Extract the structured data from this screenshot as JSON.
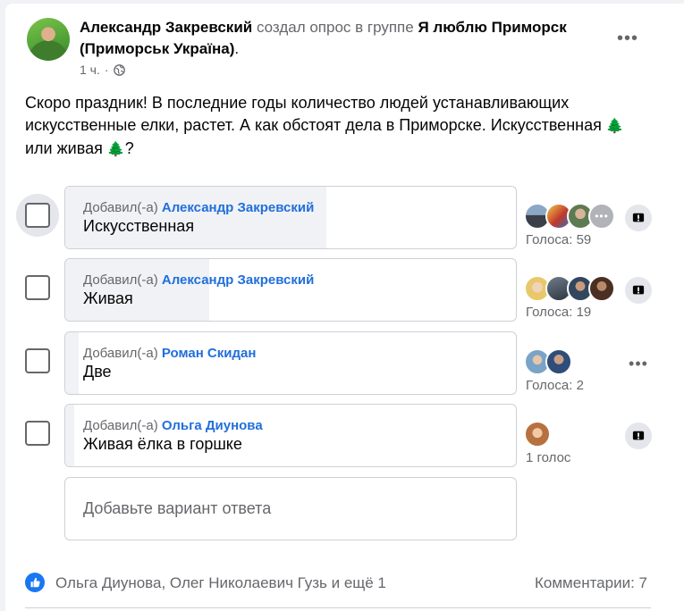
{
  "post": {
    "author": "Александр Закревский",
    "action": "создал опрос в группе",
    "group_name": "Я люблю Приморск (Приморськ Україна)",
    "period": ".",
    "time": "1 ч.",
    "dot": "·",
    "text_part1": "Скоро праздник! В последние годы количество людей устанавливающих искусственные елки, растет. А как обстоят дела в Приморске. Искусственная",
    "text_part2": "или живая",
    "text_part3": "?",
    "tree_glyph": "🌲"
  },
  "poll": {
    "added_by_prefix": "Добавил(-а)",
    "options": [
      {
        "added_by": "Александр Закревский",
        "label": "Искусственная",
        "votes_text": "Голоса: 59",
        "votes_fraction": 0.58,
        "more_label": "•••"
      },
      {
        "added_by": "Александр Закревский",
        "label": "Живая",
        "votes_text": "Голоса: 19",
        "votes_fraction": 0.32
      },
      {
        "added_by": "Роман Скидан",
        "label": "Две",
        "votes_text": "Голоса: 2",
        "votes_fraction": 0.03
      },
      {
        "added_by": "Ольга Диунова",
        "label": "Живая ёлка в горшке",
        "votes_text": "1 голос",
        "votes_fraction": 0.02
      }
    ],
    "add_option_placeholder": "Добавьте вариант ответа",
    "option_more_label": "•••"
  },
  "footer": {
    "reactors": "Ольга Диунова, Олег Николаевич Гузь и ещё 1",
    "comments": "Комментарии: 7"
  },
  "header_more": "•••",
  "colors": {
    "accent_blue": "#216fdb",
    "like_blue": "#1877f2",
    "muted": "#65676b",
    "fill": "#f0f2f5"
  }
}
